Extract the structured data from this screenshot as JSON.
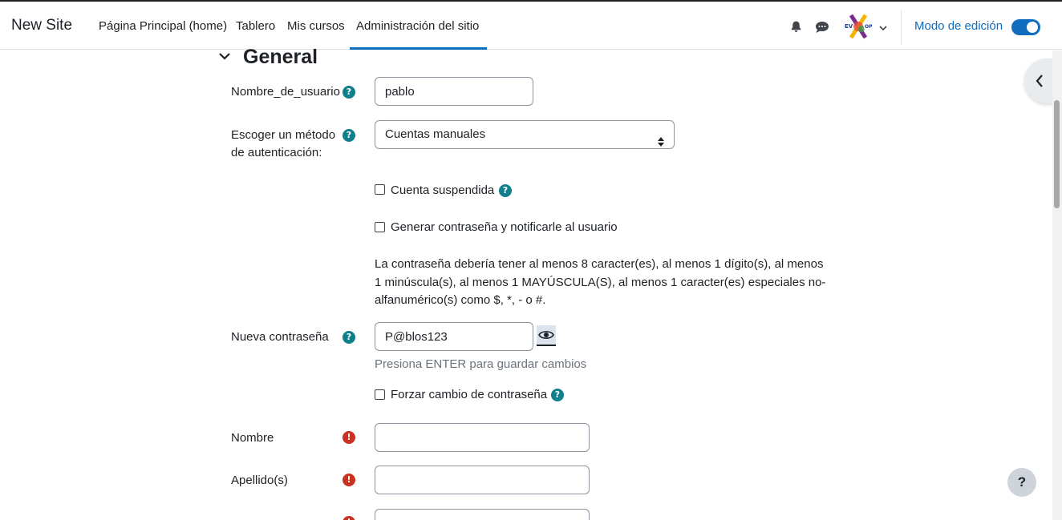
{
  "site": {
    "brand": "New Site"
  },
  "nav": {
    "items": [
      {
        "label": "Página Principal (home)"
      },
      {
        "label": "Tablero"
      },
      {
        "label": "Mis cursos"
      },
      {
        "label": "Administración del sitio",
        "active": true
      }
    ],
    "edit_mode_label": "Modo de edición",
    "edit_mode_on": true,
    "icons": [
      "bell-icon",
      "chat-icon",
      "avatar",
      "chevron-down-icon"
    ]
  },
  "section": {
    "title": "General",
    "expanded": true
  },
  "form": {
    "username": {
      "label": "Nombre_de_usuario",
      "value": "pablo"
    },
    "auth": {
      "label_line1": "Escoger un método",
      "label_line2": "de autenticación:",
      "selected": "Cuentas manuales"
    },
    "suspended": {
      "label": "Cuenta suspendida",
      "checked": false
    },
    "generate_password": {
      "label": "Generar contraseña y notificarle al usuario",
      "checked": false
    },
    "password_policy": "La contraseña debería tener al menos 8 caracter(es), al menos 1 dígito(s), al menos 1 minúscula(s), al menos 1 MAYÚSCULA(S), al menos 1 caracter(es) especiales no-alfanumérico(s) como $, *, - o #.",
    "new_password": {
      "label": "Nueva contraseña",
      "value": "P@blos123",
      "hint": "Presiona ENTER para guardar cambios"
    },
    "force_change": {
      "label": "Forzar cambio de contraseña",
      "checked": false
    },
    "first_name": {
      "label": "Nombre",
      "value": ""
    },
    "last_name": {
      "label": "Apellido(s)",
      "value": ""
    }
  },
  "help_button": {
    "label": "?"
  },
  "colors": {
    "accent": "#0f6cbf",
    "help": "#0f7f8c",
    "required": "#ca3120"
  }
}
